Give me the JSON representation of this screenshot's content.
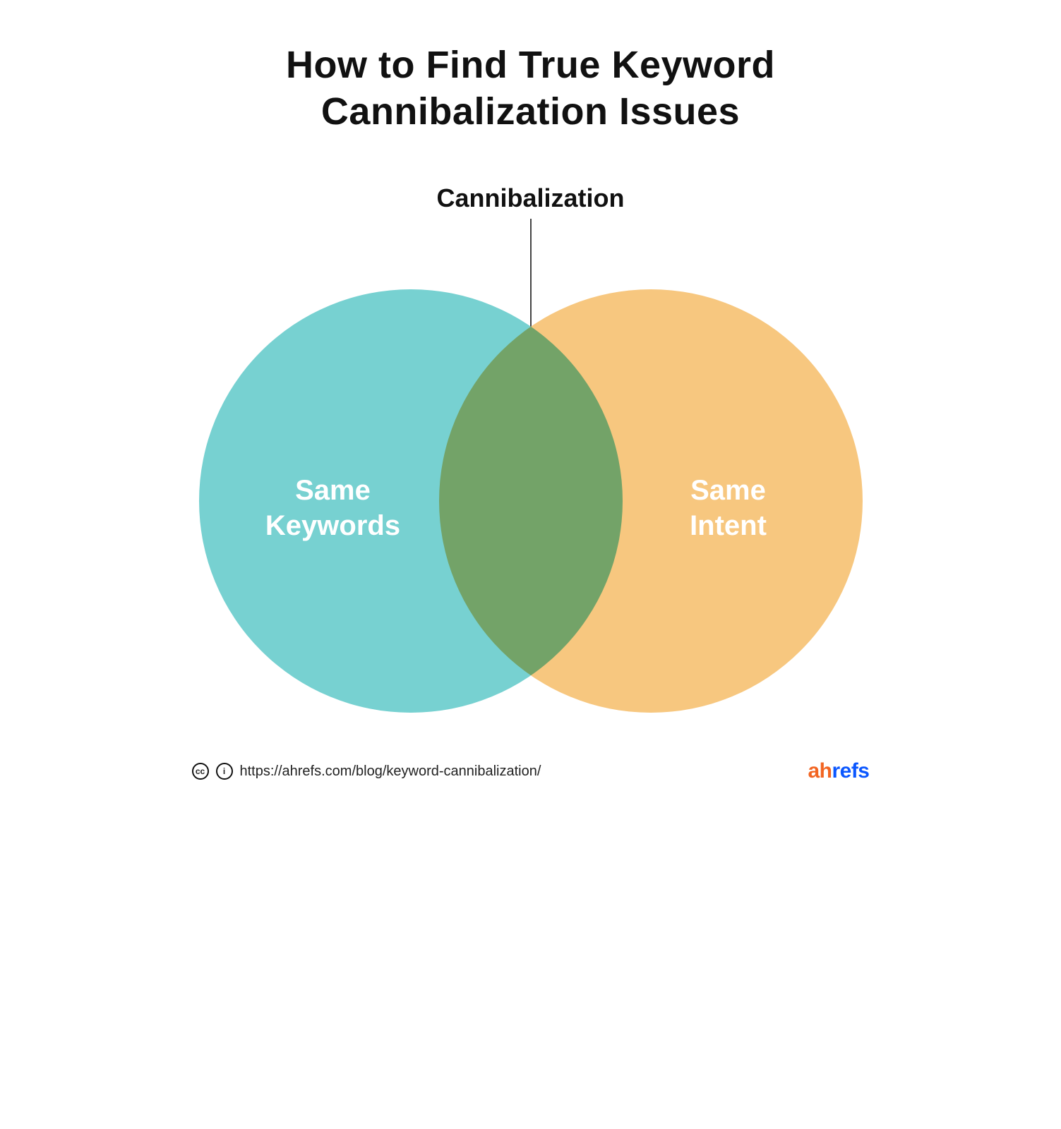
{
  "title": "How to Find True Keyword Cannibalization Issues",
  "intersection_label": "Cannibalization",
  "venn": {
    "left_label": "Same\nKeywords",
    "right_label": "Same\nIntent",
    "left_color": "#77d1d1",
    "right_color": "#f7c77f",
    "overlap_color": "#c18ae6"
  },
  "footer": {
    "cc_label": "cc",
    "by_label": "i",
    "url_text": "https://ahrefs.com/blog/keyword-cannibalization/"
  },
  "brand": {
    "part1": "ah",
    "part2": "refs"
  }
}
